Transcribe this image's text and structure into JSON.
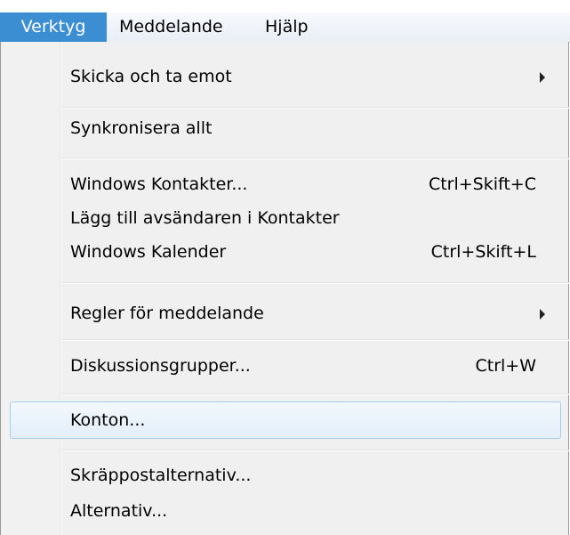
{
  "menubar": {
    "items": [
      {
        "label": "Verktyg",
        "active": true
      },
      {
        "label": "Meddelande",
        "active": false
      },
      {
        "label": "Hjälp",
        "active": false
      }
    ]
  },
  "menu": {
    "items": [
      {
        "label": "Skicka och ta emot",
        "shortcut": "",
        "submenu": true
      },
      {
        "label": "Synkronisera allt",
        "shortcut": "",
        "submenu": false
      },
      {
        "label": "Windows Kontakter...",
        "shortcut": "Ctrl+Skift+C",
        "submenu": false
      },
      {
        "label": "Lägg till avsändaren i Kontakter",
        "shortcut": "",
        "submenu": false
      },
      {
        "label": "Windows Kalender",
        "shortcut": "Ctrl+Skift+L",
        "submenu": false
      },
      {
        "label": "Regler för meddelande",
        "shortcut": "",
        "submenu": true
      },
      {
        "label": "Diskussionsgrupper...",
        "shortcut": "Ctrl+W",
        "submenu": false
      },
      {
        "label": "Konton...",
        "shortcut": "",
        "submenu": false,
        "highlighted": true
      },
      {
        "label": "Skräppostalternativ...",
        "shortcut": "",
        "submenu": false
      },
      {
        "label": "Alternativ...",
        "shortcut": "",
        "submenu": false
      }
    ]
  },
  "colors": {
    "menubar_active_bg": "#3c8ed3",
    "highlight_border": "#a8cce9",
    "menu_bg": "#f0f0f0"
  }
}
